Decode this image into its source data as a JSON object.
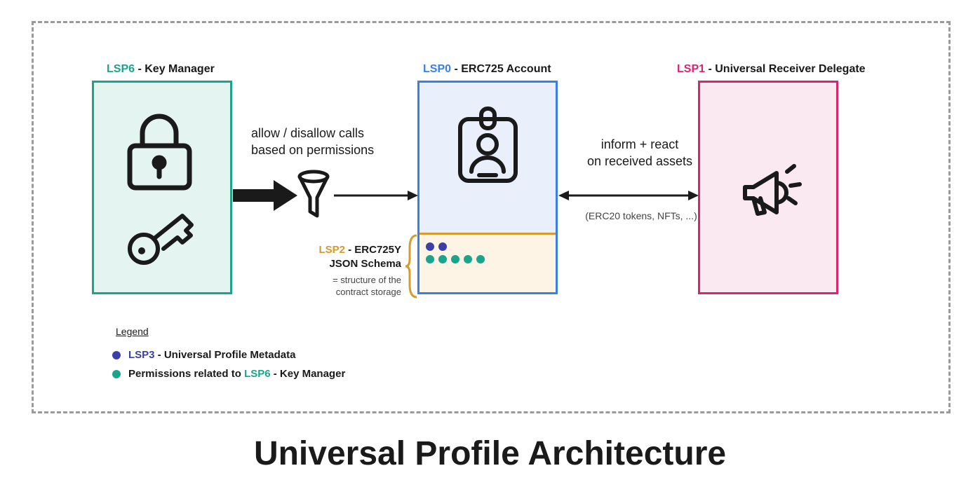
{
  "title": "Universal Profile Architecture",
  "boxes": {
    "lsp6": {
      "tag": "LSP6",
      "label": " - Key Manager",
      "color": "#1aa58a"
    },
    "lsp0": {
      "tag": "LSP0",
      "label": " - ERC725 Account",
      "color": "#3a7fe6"
    },
    "lsp1": {
      "tag": "LSP1",
      "label": " - Universal Receiver Delegate",
      "color": "#d6276e"
    }
  },
  "arrows": {
    "left_label_line1": "allow / disallow calls",
    "left_label_line2": "based on permissions",
    "right_label_line1": "inform + react",
    "right_label_line2": "on received assets",
    "right_sub": "(ERC20 tokens, NFTs, ...)"
  },
  "lsp2": {
    "tag": "LSP2",
    "label": " - ERC725Y JSON Schema",
    "sub": "= structure of the contract storage",
    "color": "#d99a2b"
  },
  "legend": {
    "title": "Legend",
    "items": [
      {
        "dot": "blue",
        "tag": "LSP3",
        "label": " - Universal Profile Metadata",
        "tagColor": "#3d3fa8"
      },
      {
        "dot": "teal",
        "prefix": "Permissions related to ",
        "tag": "LSP6",
        "label": " - Key Manager",
        "tagColor": "#1aa58a"
      }
    ]
  },
  "colors": {
    "dotBlue": "#3d3fa8",
    "dotTeal": "#1aa58a"
  }
}
